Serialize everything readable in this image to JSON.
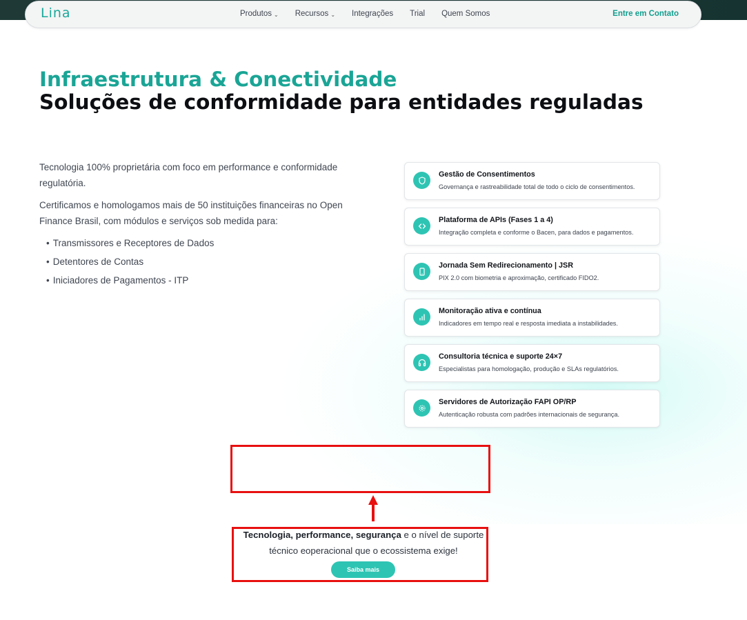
{
  "nav": {
    "logo": "Lina",
    "links": [
      {
        "label": "Produtos",
        "dropdown": true
      },
      {
        "label": "Recursos",
        "dropdown": true
      },
      {
        "label": "Integrações",
        "dropdown": false
      },
      {
        "label": "Trial",
        "dropdown": false
      },
      {
        "label": "Quem Somos",
        "dropdown": false
      }
    ],
    "contact_label": "Entre em Contato"
  },
  "hero": {
    "title_teal": "Infraestrutura & Conectividade",
    "title_dark": "Soluções de conformidade para entidades reguladas"
  },
  "intro": {
    "paragraph_1": "Tecnologia 100% proprietária com foco em performance e conformidade regulatória.",
    "paragraph_2": "Certificamos e homologamos mais de 50 instituições financeiras no Open Finance Brasil, com módulos e serviços sob medida para:",
    "bullets": [
      "Transmissores e Receptores de Dados",
      "Detentores de Contas",
      "Iniciadores de Pagamentos - ITP"
    ]
  },
  "cards": [
    {
      "icon": "shield-icon",
      "title": "Gestão de Consentimentos",
      "desc": "Governança e rastreabilidade total de todo o ciclo de consentimentos."
    },
    {
      "icon": "code-icon",
      "title": "Plataforma de APIs (Fases 1 a 4)",
      "desc": "Integração completa e conforme o Bacen, para dados e pagamentos."
    },
    {
      "icon": "smartphone-icon",
      "title": "Jornada Sem Redirecionamento | JSR",
      "desc": "PIX 2.0 com biometria e aproximação, certificado FIDO2."
    },
    {
      "icon": "bar-chart-icon",
      "title": "Monitoração ativa e contínua",
      "desc": "Indicadores em tempo real e resposta imediata a instabilidades."
    },
    {
      "icon": "headphones-icon",
      "title": "Consultoria técnica e suporte 24×7",
      "desc": "Especialistas para homologação, produção e SLAs regulatórios."
    },
    {
      "icon": "gear-icon",
      "title": "Servidores de Autorização FAPI OP/RP",
      "desc": "Autenticação robusta com padrões internacionais de segurança."
    }
  ],
  "cta": {
    "bold_1": "Tecnologia",
    "sep_1": ", ",
    "bold_2": "performance",
    "sep_2": ", ",
    "bold_3": "segurança",
    "rest": " e o nível de suporte técnico eoperacional que o ecossistema exige!",
    "button_label": "Saiba mais"
  },
  "colors": {
    "accent": "#2ec4b3",
    "heading_teal": "#1aa596",
    "annotation_red": "#e80f0f"
  }
}
